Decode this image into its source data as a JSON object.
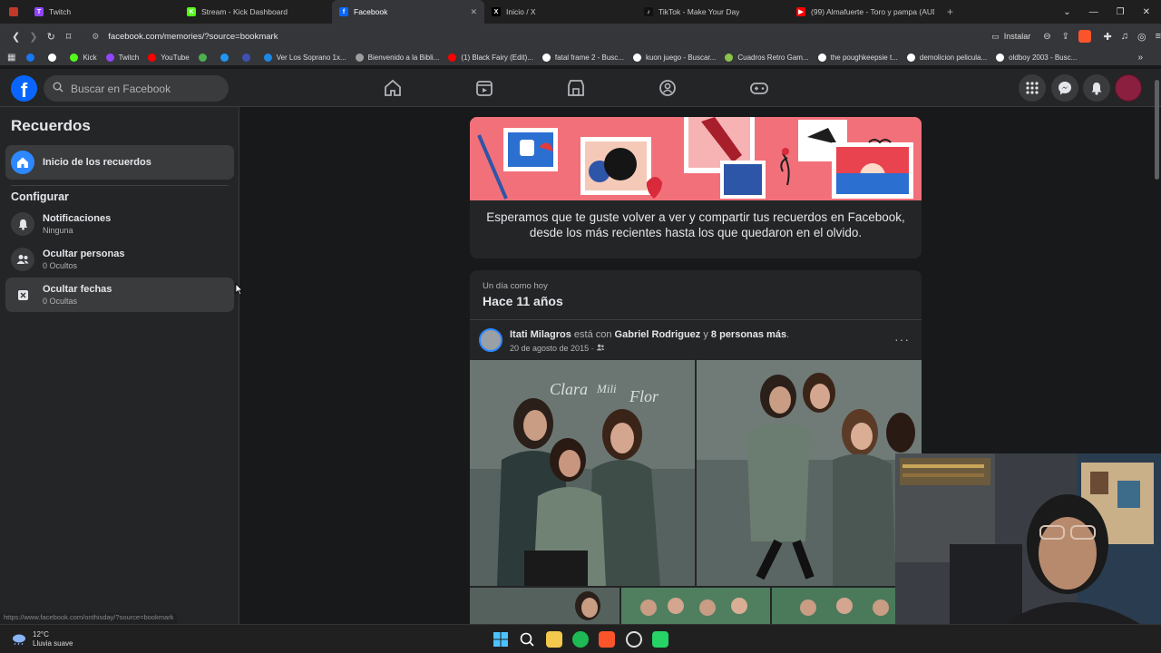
{
  "browser": {
    "tabs": [
      {
        "label": "Twitch",
        "color": "#9146ff",
        "glyph": "T"
      },
      {
        "label": "Stream - Kick Dashboard",
        "color": "#53fc18",
        "glyph": "K"
      },
      {
        "label": "Facebook",
        "color": "#0866ff",
        "glyph": "f",
        "active": true
      },
      {
        "label": "Inicio / X",
        "color": "#000000",
        "glyph": "X"
      },
      {
        "label": "TikTok - Make Your Day",
        "color": "#111111",
        "glyph": "♪"
      },
      {
        "label": "(99) Almafuerte - Toro y pampa (AUD",
        "color": "#ff0000",
        "glyph": "▶"
      }
    ],
    "url": "facebook.com/memories/?source=bookmark",
    "install_label": "Instalar",
    "bookmarks": [
      {
        "label": "",
        "color": "#1877f2"
      },
      {
        "label": "",
        "color": "#ffffff"
      },
      {
        "label": "Kick",
        "color": "#53fc18"
      },
      {
        "label": "Twitch",
        "color": "#9146ff"
      },
      {
        "label": "YouTube",
        "color": "#ff0000"
      },
      {
        "label": "",
        "color": "#4caf50"
      },
      {
        "label": "",
        "color": "#2196f3"
      },
      {
        "label": "",
        "color": "#3f51b5"
      },
      {
        "label": "Ver Los Soprano 1x...",
        "color": "#1e88e5"
      },
      {
        "label": "Bienvenido a la Bibli...",
        "color": "#9e9e9e"
      },
      {
        "label": "(1) Black Fairy (Edit)...",
        "color": "#ff0000"
      },
      {
        "label": "fatal frame 2 - Busc...",
        "color": "#ffffff"
      },
      {
        "label": "kuon juego - Buscar...",
        "color": "#ffffff"
      },
      {
        "label": "Cuadros Retro Gam...",
        "color": "#8bc34a"
      },
      {
        "label": "the poughkeepsie t...",
        "color": "#ffffff"
      },
      {
        "label": "demolicion pelicula...",
        "color": "#ffffff"
      },
      {
        "label": "oldboy 2003 - Busc...",
        "color": "#ffffff"
      }
    ]
  },
  "fb": {
    "search_placeholder": "Buscar en Facebook",
    "brand_color": "#0866ff"
  },
  "sidebar": {
    "title": "Recuerdos",
    "home_label": "Inicio de los recuerdos",
    "config_title": "Configurar",
    "items": [
      {
        "label": "Notificaciones",
        "sub": "Ninguna",
        "icon": "bell-icon"
      },
      {
        "label": "Ocultar personas",
        "sub": "0 Ocultos",
        "icon": "people-icon"
      },
      {
        "label": "Ocultar fechas",
        "sub": "0 Ocultas",
        "icon": "calendar-x-icon"
      }
    ],
    "status_url": "https://www.facebook.com/onthisday/?source=bookmark"
  },
  "banner": {
    "text": "Esperamos que te guste volver a ver y compartir tus recuerdos en Facebook, desde los más recientes hasta los que quedaron en el olvido."
  },
  "memory": {
    "subtitle": "Un día como hoy",
    "title": "Hace 11 años",
    "author": "Itati Milagros",
    "with_text": " está con ",
    "tagged": "Gabriel Rodriguez",
    "and_text": " y ",
    "others": "8 personas más",
    "period": ".",
    "date": "20 de agosto de 2015 · ",
    "menu_label": "···"
  },
  "taskbar": {
    "temperature": "12°C",
    "weather": "Lluvia suave"
  }
}
